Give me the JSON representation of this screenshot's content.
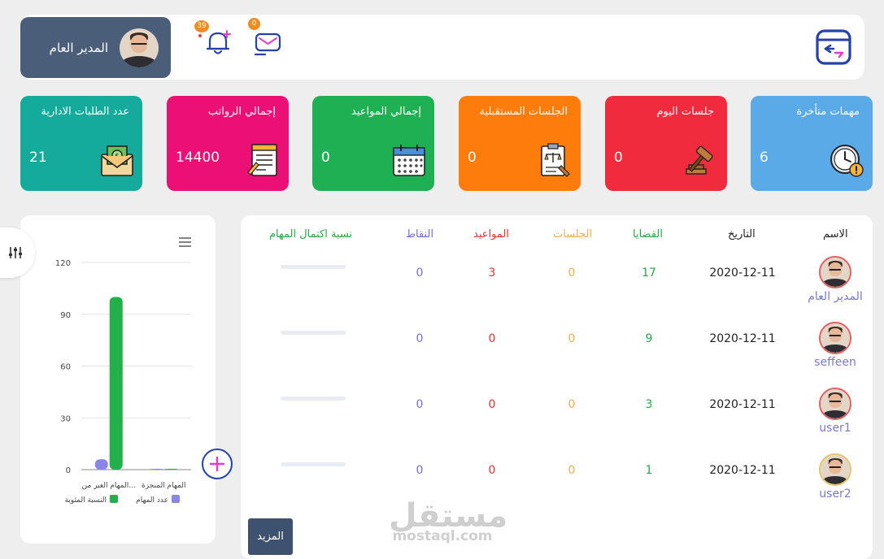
{
  "header": {
    "user_name": "المدير العام",
    "notifications_count": "39",
    "messages_count": "0"
  },
  "cards": [
    {
      "title": "عدد الطلبات الادارية",
      "value": "21",
      "color": "#14ab9c",
      "icon": "money-envelope-icon"
    },
    {
      "title": "إجمالي الرواتب",
      "value": "14400",
      "color": "#ec0f75",
      "icon": "document-list-icon"
    },
    {
      "title": "إجمالي المواعيد",
      "value": "0",
      "color": "#20b054",
      "icon": "calendar-icon"
    },
    {
      "title": "الجلسات المستقبلية",
      "value": "0",
      "color": "#fd7c0c",
      "icon": "legal-document-icon"
    },
    {
      "title": "جلسات اليوم",
      "value": "0",
      "color": "#f12b3e",
      "icon": "gavel-icon"
    },
    {
      "title": "مهمات متأخرة",
      "value": "6",
      "color": "#5aaae8",
      "icon": "clock-warning-icon"
    }
  ],
  "table": {
    "headers": {
      "name": "الاسم",
      "date": "التاريخ",
      "cases": "القضايا",
      "sessions": "الجلسات",
      "appointments": "المواعيد",
      "points": "النقاط",
      "completion": "نسبة اكتمال المهام"
    },
    "header_colors": {
      "name": "#222222",
      "date": "#222222",
      "cases": "#28a745",
      "sessions": "#f0ad4e",
      "appointments": "#e3342f",
      "points": "#6f6fd8",
      "completion": "#28a745"
    },
    "rows": [
      {
        "name": "المدير العام",
        "date": "2020-12-11",
        "cases": "17",
        "sessions": "0",
        "appointments": "3",
        "points": "0",
        "completion": 0
      },
      {
        "name": "seffeen",
        "date": "2020-12-11",
        "cases": "9",
        "sessions": "0",
        "appointments": "0",
        "points": "0",
        "completion": 0
      },
      {
        "name": "user1",
        "date": "2020-12-11",
        "cases": "3",
        "sessions": "0",
        "appointments": "0",
        "points": "0",
        "completion": 0
      },
      {
        "name": "user2",
        "date": "2020-12-11",
        "cases": "1",
        "sessions": "0",
        "appointments": "0",
        "points": "0",
        "completion": 0
      }
    ],
    "more_label": "المزيد"
  },
  "chart_data": {
    "type": "bar",
    "categories": [
      "المهام الغير من...",
      "المهام المنجزة"
    ],
    "series": [
      {
        "name": "عدد المهام",
        "color": "#8a86e8",
        "values": [
          6,
          0
        ]
      },
      {
        "name": "النسبة المئوية",
        "color": "#21b04a",
        "values": [
          100,
          0
        ]
      }
    ],
    "yticks": [
      "120",
      "90",
      "60",
      "30",
      "0"
    ],
    "ylim": [
      0,
      120
    ],
    "grid": true,
    "legend": "bottom"
  },
  "watermark": {
    "arabic": "مستقل",
    "latin": "mostaql.com"
  }
}
